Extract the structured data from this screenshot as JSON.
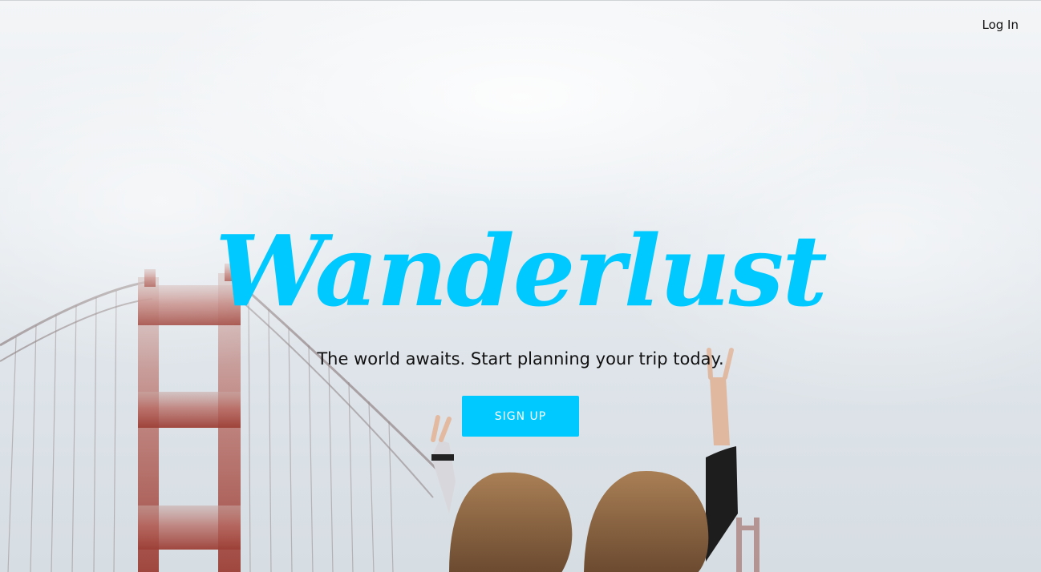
{
  "nav": {
    "login_label": "Log In"
  },
  "hero": {
    "brand": "Wanderlust",
    "tagline": "The world awaits. Start planning your trip today.",
    "signup_label": "SIGN UP"
  },
  "colors": {
    "accent": "#00c9ff",
    "bridge": "#b2584f"
  }
}
